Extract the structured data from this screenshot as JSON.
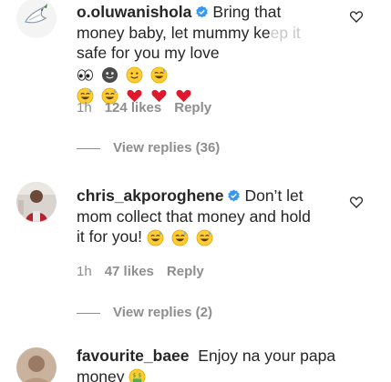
{
  "comments": [
    {
      "username": "o.oluwanishola",
      "verified": true,
      "text_line1": "Bring that",
      "text_line2a": "money baby, let mummy ke",
      "text_line2b": "ep it",
      "text_line3": "safe for you my love",
      "time": "1h",
      "likes": "124 likes",
      "reply": "Reply",
      "view_replies": "View replies (36)",
      "emojis": [
        "eyes",
        "slightly-smiling-face",
        "smiling-face",
        "grinning-sweat-face",
        "grinning-sweat-face",
        "grinning-sweat-face",
        "red-heart",
        "red-heart",
        "red-heart"
      ]
    },
    {
      "username": "chris_akporoghene",
      "verified": true,
      "text_line1": "Don’t let",
      "text_line2": "mom collect that money and hold",
      "text_line3": "it for you!",
      "time": "1h",
      "likes": "47 likes",
      "reply": "Reply",
      "view_replies": "View replies (2)",
      "emojis": [
        "grinning-sweat-face",
        "grinning-sweat-face",
        "grinning-sweat-face"
      ]
    },
    {
      "username": "favourite_baee",
      "verified": false,
      "text_line1": "Enjoy na your papa",
      "text_line2": "money",
      "emojis": [
        "money-mouth-face"
      ]
    }
  ],
  "colors": {
    "text": "#262626",
    "meta": "#8e8e8e",
    "verified": "#3897f0",
    "heart_outline": "#262626",
    "red_heart": "#e0182d"
  }
}
